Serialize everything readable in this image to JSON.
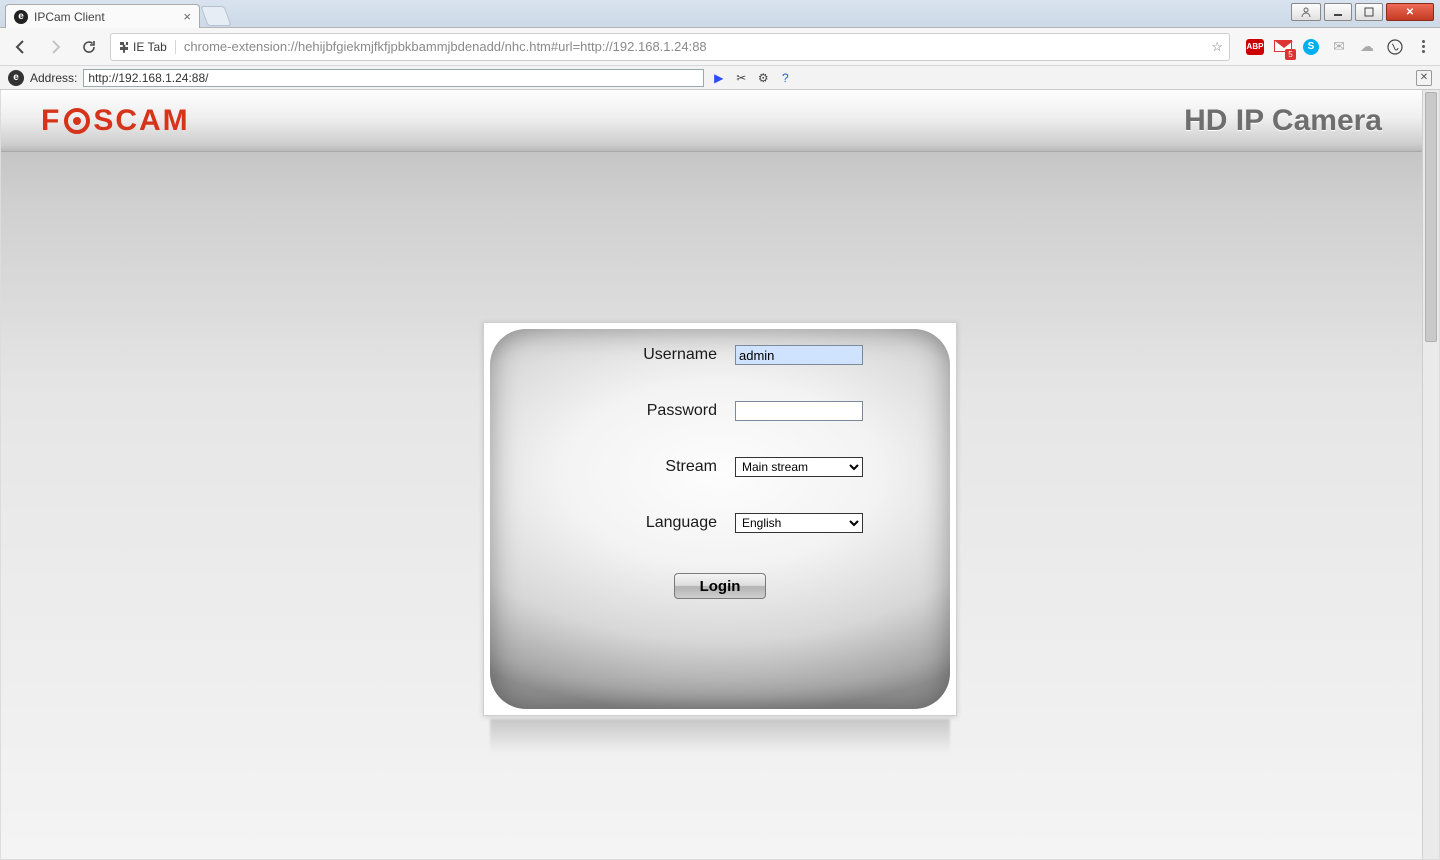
{
  "browser": {
    "tab_title": "IPCam Client",
    "extension_chip": "IE Tab",
    "omnibox_url": "chrome-extension://hehijbfgiekmjfkfjpbkbammjbdenadd/nhc.htm#url=http://192.168.1.24:88",
    "gmail_unread": "5",
    "abp_label": "ABP"
  },
  "ietab": {
    "address_label": "Address:",
    "address_value": "http://192.168.1.24:88/"
  },
  "header": {
    "brand_pre": "F",
    "brand_post": "SCAM",
    "product": "HD IP Camera"
  },
  "login": {
    "username_label": "Username",
    "username_value": "admin",
    "password_label": "Password",
    "password_value": "",
    "stream_label": "Stream",
    "stream_value": "Main stream",
    "language_label": "Language",
    "language_value": "English",
    "login_button": "Login"
  }
}
